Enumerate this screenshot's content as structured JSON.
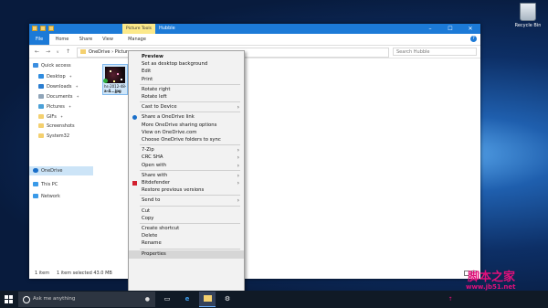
{
  "desktop": {
    "recycle_bin_label": "Recycle Bin"
  },
  "window": {
    "context_tab": "Picture Tools",
    "title": "Hubble",
    "ribbon_tabs": [
      "File",
      "Home",
      "Share",
      "View",
      "Manage"
    ],
    "path_parts": [
      "OneDrive",
      "Pictur"
    ],
    "search_placeholder": "Search Hubble",
    "nav": {
      "quick_access": "Quick access",
      "items": [
        {
          "label": "Desktop",
          "pinned": true
        },
        {
          "label": "Downloads",
          "pinned": true
        },
        {
          "label": "Documents",
          "pinned": true
        },
        {
          "label": "Pictures",
          "pinned": true
        },
        {
          "label": "GIFs",
          "pinned": true
        },
        {
          "label": "Screenshots",
          "pinned": false
        },
        {
          "label": "System32",
          "pinned": false
        }
      ],
      "onedrive": "OneDrive",
      "this_pc": "This PC",
      "network": "Network"
    },
    "file": {
      "name_line1": "hs-2012-48-",
      "name_line2": "a-4...jpg"
    },
    "status": {
      "count": "1 item",
      "selected": "1 item selected  43.0 MB"
    }
  },
  "context_menu": {
    "items": [
      {
        "label": "Preview",
        "bold": true
      },
      {
        "label": "Set as desktop background"
      },
      {
        "label": "Edit"
      },
      {
        "label": "Print"
      },
      {
        "sep": true
      },
      {
        "label": "Rotate right"
      },
      {
        "label": "Rotate left"
      },
      {
        "sep": true
      },
      {
        "label": "Cast to Device",
        "submenu": true
      },
      {
        "sep": true
      },
      {
        "label": "Share a OneDrive link",
        "icon": "onedrive-icon"
      },
      {
        "label": "More OneDrive sharing options"
      },
      {
        "label": "View on OneDrive.com"
      },
      {
        "label": "Choose OneDrive folders to sync"
      },
      {
        "sep": true
      },
      {
        "label": "7-Zip",
        "submenu": true
      },
      {
        "label": "CRC SHA",
        "submenu": true
      },
      {
        "label": "Open with",
        "submenu": true
      },
      {
        "sep": true
      },
      {
        "label": "Share with",
        "submenu": true
      },
      {
        "label": "Bitdefender",
        "submenu": true,
        "icon": "bitdefender-icon"
      },
      {
        "label": "Restore previous versions"
      },
      {
        "sep": true
      },
      {
        "label": "Send to",
        "submenu": true
      },
      {
        "sep": true
      },
      {
        "label": "Cut"
      },
      {
        "label": "Copy"
      },
      {
        "sep": true
      },
      {
        "label": "Create shortcut"
      },
      {
        "label": "Delete"
      },
      {
        "label": "Rename"
      },
      {
        "sep": true
      },
      {
        "label": "Properties",
        "highlighted": true
      }
    ]
  },
  "taskbar": {
    "search_placeholder": "Ask me anything"
  },
  "watermark": {
    "line1": "脚本之家",
    "line2": "www.jb51.net"
  },
  "colors": {
    "accent": "#1c7ad7",
    "picture_tools": "#fce98a",
    "taskbar": "#101a26"
  }
}
